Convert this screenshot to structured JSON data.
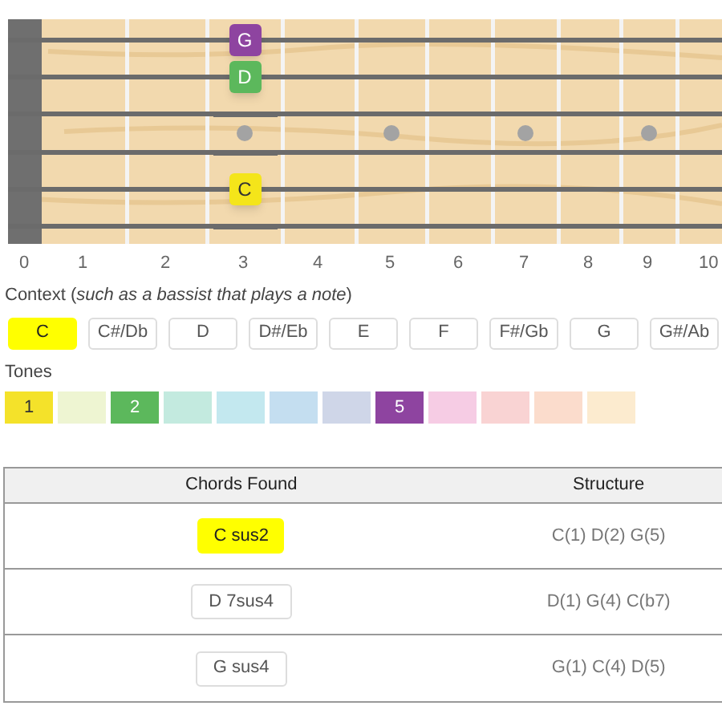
{
  "fretboard": {
    "frets": [
      {
        "number": "0"
      },
      {
        "number": "1"
      },
      {
        "number": "2"
      },
      {
        "number": "3",
        "strings": [
          {
            "kind": "note",
            "label": "G",
            "color": "#8e44a0"
          },
          {
            "kind": "note",
            "label": "D",
            "color": "#5cb85c"
          },
          {
            "kind": "open"
          },
          {
            "kind": "open"
          },
          {
            "kind": "note",
            "label": "C",
            "color": "#f4e51a"
          },
          {
            "kind": "open"
          }
        ]
      },
      {
        "number": "4"
      },
      {
        "number": "5"
      },
      {
        "number": "6"
      },
      {
        "number": "7"
      },
      {
        "number": "8"
      },
      {
        "number": "9"
      },
      {
        "number": "10"
      }
    ]
  },
  "context": {
    "label": "Context (*such as a bassist that plays a note*)",
    "keys": [
      {
        "label": "C",
        "selected": true
      },
      {
        "label": "C#/Db",
        "selected": false
      },
      {
        "label": "D",
        "selected": false
      },
      {
        "label": "D#/Eb",
        "selected": false
      },
      {
        "label": "E",
        "selected": false
      },
      {
        "label": "F",
        "selected": false
      },
      {
        "label": "F#/Gb",
        "selected": false
      },
      {
        "label": "G",
        "selected": false
      },
      {
        "label": "G#/Ab",
        "selected": false
      }
    ]
  },
  "tones": {
    "label": "Tones",
    "swatches": [
      {
        "label": "1",
        "color": "#f4e22a"
      },
      {
        "color": "#eef5d2"
      },
      {
        "label": "2",
        "color": "#5cb85c"
      },
      {
        "color": "#c3eadf"
      },
      {
        "color": "#c3e8ef"
      },
      {
        "color": "#c4def0"
      },
      {
        "color": "#cfd6e8"
      },
      {
        "label": "5",
        "color": "#8e44a0"
      },
      {
        "color": "#f6cce4"
      },
      {
        "color": "#f9d3d3"
      },
      {
        "color": "#fbdccc"
      },
      {
        "color": "#fcebcf"
      }
    ]
  },
  "table": {
    "columns": [
      "Chords Found",
      "Structure"
    ],
    "rows": [
      {
        "chord": "C sus2",
        "selected": true,
        "structure": "C(1) D(2) G(5)"
      },
      {
        "chord": "D 7sus4",
        "selected": false,
        "structure": "D(1) G(4) C(b7)"
      },
      {
        "chord": "G sus4",
        "selected": false,
        "structure": "G(1) C(4) D(5)"
      }
    ]
  }
}
